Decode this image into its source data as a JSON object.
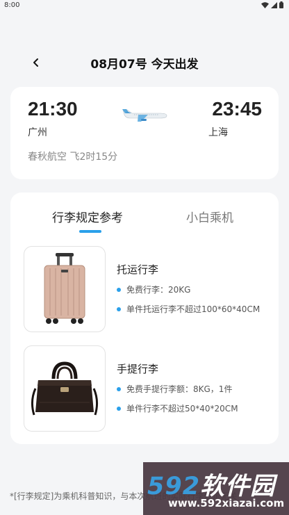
{
  "status_bar": {
    "time": "8:00"
  },
  "header": {
    "title": "08月07号 今天出发"
  },
  "flight": {
    "departure_time": "21:30",
    "departure_city": "广州",
    "arrival_time": "23:45",
    "arrival_city": "上海",
    "airline_duration": "春秋航空 飞2时15分"
  },
  "tabs": [
    {
      "label": "行李规定参考",
      "active": true
    },
    {
      "label": "小白乘机",
      "active": false
    }
  ],
  "luggage": [
    {
      "title": "托运行李",
      "bullets": [
        "免费行李：20KG",
        "单件托运行李不超过100*60*40CM"
      ]
    },
    {
      "title": "手提行李",
      "bullets": [
        "免费手提行李额：8KG，1件",
        "单件行李不超过50*40*20CM"
      ]
    }
  ],
  "footer_note": "*[行李规定]为乘机科普知识，与本次航班的实际行李规定无关",
  "watermark": {
    "brand_number": "592",
    "brand_text": "软件园",
    "url": "www.592xiazai.com"
  },
  "colors": {
    "accent": "#2aa0ea",
    "background": "#f4f5f7",
    "card": "#ffffff"
  }
}
